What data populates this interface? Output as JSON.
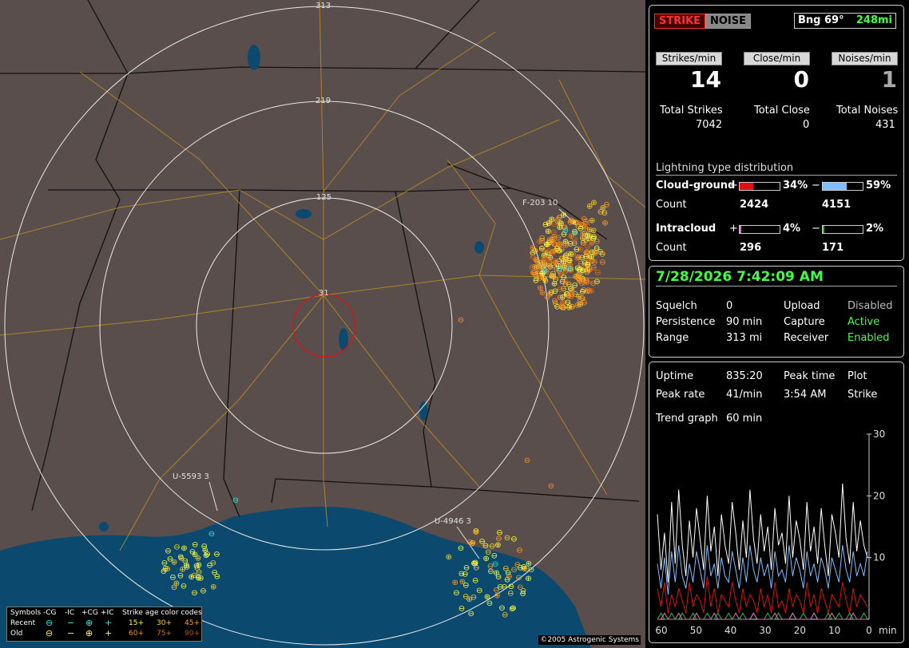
{
  "app": {
    "copyright": "©2005 Astrogenic Systems"
  },
  "header": {
    "strike_tab": "STRIKE",
    "noise_tab": "NOISE",
    "bearing": "Bng 69°",
    "distance": "248mi"
  },
  "rates": {
    "strikes_label": "Strikes/min",
    "close_label": "Close/min",
    "noises_label": "Noises/min",
    "strikes": "14",
    "close": "0",
    "noises": "1"
  },
  "totals": {
    "strikes_label": "Total Strikes",
    "close_label": "Total Close",
    "noises_label": "Total Noises",
    "strikes": "7042",
    "close": "0",
    "noises": "431"
  },
  "distribution": {
    "title": "Lightning type distribution",
    "cg_label": "Cloud-ground",
    "ic_label": "Intracloud",
    "count_label": "Count",
    "plus": "+",
    "minus": "−",
    "cg_pos_pct": "34%",
    "cg_neg_pct": "59%",
    "ic_pos_pct": "4%",
    "ic_neg_pct": "2%",
    "cg_pos_fill": 0.34,
    "cg_neg_fill": 0.59,
    "ic_pos_fill": 0.04,
    "ic_neg_fill": 0.02,
    "cg_pos_count": "2424",
    "cg_neg_count": "4151",
    "ic_pos_count": "296",
    "ic_neg_count": "171",
    "colors": {
      "cg_pos": "#e01010",
      "cg_neg": "#7fbfff",
      "ic_pos": "#e070c0",
      "ic_neg": "#20c040"
    }
  },
  "status": {
    "datetime": "7/28/2026 7:42:09 AM",
    "squelch_label": "Squelch",
    "squelch": "0",
    "persistence_label": "Persistence",
    "persistence": "90 min",
    "range_label": "Range",
    "range": "313 mi",
    "upload_label": "Upload",
    "upload": "Disabled",
    "capture_label": "Capture",
    "capture": "Active",
    "receiver_label": "Receiver",
    "receiver": "Enabled"
  },
  "stats": {
    "uptime_label": "Uptime",
    "uptime": "835:20",
    "peak_time_label": "Peak time",
    "peak_time": "3:54 AM",
    "plot_label": "Plot",
    "plot": "Strike",
    "peak_rate_label": "Peak rate",
    "peak_rate": "41/min",
    "trend_label": "Trend graph",
    "trend": "60 min"
  },
  "map": {
    "range_labels": [
      "313",
      "219",
      "125",
      "31"
    ],
    "strike_labels": [
      "F-203  10",
      "U-5593  3",
      "U-4946  3"
    ]
  },
  "legend": {
    "symbols": "Symbols",
    "neg_cg": "-CG",
    "neg_ic": "-IC",
    "pos_cg": "+CG",
    "pos_ic": "+IC",
    "age_title": "Strike age color codes",
    "recent": "Recent",
    "old": "Old",
    "ages_recent": [
      "15+",
      "30+",
      "45+"
    ],
    "ages_old": [
      "60+",
      "75+",
      "90+"
    ]
  },
  "chart_data": {
    "type": "line",
    "xlabel": "min",
    "x_ticks": [
      "60",
      "50",
      "40",
      "30",
      "20",
      "10",
      "0"
    ],
    "y_ticks": [
      "30",
      "20",
      "10"
    ],
    "ylim": [
      0,
      30
    ],
    "series": [
      {
        "color": "#ffffff",
        "values": [
          17,
          8,
          14,
          6,
          19,
          9,
          21,
          12,
          7,
          16,
          10,
          18,
          13,
          8,
          20,
          11,
          15,
          7,
          17,
          12,
          9,
          19,
          14,
          8,
          16,
          10,
          21,
          13,
          9,
          17,
          11,
          15,
          8,
          18,
          12,
          14,
          9,
          20,
          10,
          16,
          13,
          8,
          19,
          11,
          15,
          9,
          18,
          12,
          7,
          17,
          14,
          10,
          22,
          13,
          9,
          19,
          11,
          16,
          12,
          10
        ]
      },
      {
        "color": "#7fbfff",
        "values": [
          9,
          5,
          10,
          4,
          11,
          6,
          12,
          7,
          5,
          9,
          6,
          11,
          8,
          5,
          12,
          7,
          9,
          5,
          10,
          7,
          6,
          11,
          8,
          5,
          10,
          6,
          12,
          8,
          6,
          10,
          7,
          9,
          5,
          11,
          7,
          8,
          6,
          12,
          7,
          10,
          8,
          5,
          11,
          7,
          9,
          6,
          10,
          8,
          5,
          10,
          8,
          6,
          12,
          8,
          6,
          11,
          7,
          9,
          7,
          11
        ]
      },
      {
        "color": "#e01010",
        "values": [
          5,
          2,
          6,
          1,
          4,
          2,
          5,
          3,
          1,
          6,
          2,
          4,
          3,
          1,
          7,
          2,
          5,
          1,
          4,
          3,
          2,
          6,
          3,
          1,
          5,
          2,
          4,
          3,
          1,
          5,
          2,
          4,
          1,
          6,
          2,
          3,
          1,
          5,
          2,
          4,
          3,
          1,
          6,
          2,
          4,
          1,
          5,
          3,
          1,
          4,
          3,
          2,
          6,
          3,
          1,
          5,
          2,
          4,
          3,
          2
        ]
      },
      {
        "color": "#20c040",
        "values": [
          0,
          1,
          0,
          0,
          1,
          0,
          0,
          1,
          0,
          0,
          1,
          0,
          0,
          0,
          1,
          0,
          0,
          1,
          0,
          0,
          1,
          0,
          0,
          0,
          1,
          0,
          0,
          1,
          0,
          0,
          0,
          1,
          0,
          0,
          1,
          0,
          0,
          0,
          1,
          0,
          0,
          1,
          0,
          0,
          1,
          0,
          0,
          0,
          1,
          0,
          0,
          1,
          0,
          0,
          1,
          0,
          0,
          0,
          1,
          0
        ]
      },
      {
        "color": "#e070c0",
        "values": [
          0,
          0,
          1,
          0,
          0,
          0,
          1,
          0,
          0,
          0,
          0,
          1,
          0,
          0,
          0,
          0,
          1,
          0,
          0,
          0,
          0,
          0,
          1,
          0,
          0,
          0,
          0,
          1,
          0,
          0,
          0,
          0,
          0,
          1,
          0,
          0,
          0,
          0,
          1,
          0,
          0,
          0,
          0,
          0,
          1,
          0,
          0,
          0,
          0,
          1,
          0,
          0,
          0,
          0,
          0,
          1,
          0,
          0,
          0,
          0
        ]
      }
    ]
  }
}
